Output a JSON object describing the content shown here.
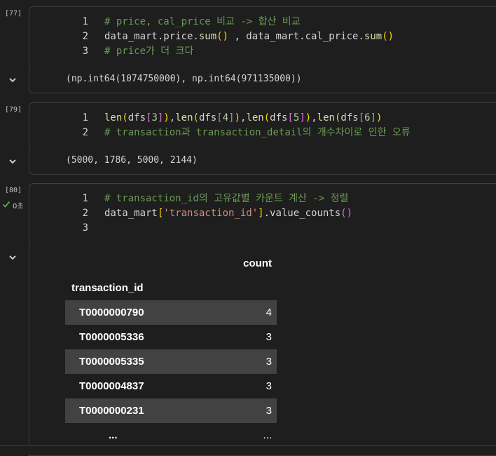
{
  "cells": [
    {
      "exec_count": "[77]",
      "lines": [
        {
          "num": "1",
          "segments": [
            {
              "text": "# price, cal_price 비교 -> 합산 비교",
              "cls": "cm"
            }
          ]
        },
        {
          "num": "2",
          "segments": [
            {
              "text": "data_mart.price.",
              "cls": ""
            },
            {
              "text": "sum",
              "cls": "fn"
            },
            {
              "text": "()",
              "cls": "paren"
            },
            {
              "text": " , data_mart.cal_price.",
              "cls": ""
            },
            {
              "text": "sum",
              "cls": "fn"
            },
            {
              "text": "()",
              "cls": "paren"
            }
          ]
        },
        {
          "num": "3",
          "segments": [
            {
              "text": "# price가 더 크다",
              "cls": "cm"
            }
          ]
        }
      ],
      "output": "(np.int64(1074750000), np.int64(971135000))"
    },
    {
      "exec_count": "[79]",
      "lines": [
        {
          "num": "1",
          "segments": [
            {
              "text": "len",
              "cls": "fn"
            },
            {
              "text": "(",
              "cls": "paren"
            },
            {
              "text": "dfs",
              "cls": ""
            },
            {
              "text": "[",
              "cls": "brk"
            },
            {
              "text": "3",
              "cls": "num"
            },
            {
              "text": "]",
              "cls": "brk"
            },
            {
              "text": ")",
              "cls": "paren"
            },
            {
              "text": ",",
              "cls": ""
            },
            {
              "text": "len",
              "cls": "fn"
            },
            {
              "text": "(",
              "cls": "paren"
            },
            {
              "text": "dfs",
              "cls": ""
            },
            {
              "text": "[",
              "cls": "brk"
            },
            {
              "text": "4",
              "cls": "num"
            },
            {
              "text": "]",
              "cls": "brk"
            },
            {
              "text": ")",
              "cls": "paren"
            },
            {
              "text": ",",
              "cls": ""
            },
            {
              "text": "len",
              "cls": "fn"
            },
            {
              "text": "(",
              "cls": "paren"
            },
            {
              "text": "dfs",
              "cls": ""
            },
            {
              "text": "[",
              "cls": "brk"
            },
            {
              "text": "5",
              "cls": "num"
            },
            {
              "text": "]",
              "cls": "brk"
            },
            {
              "text": ")",
              "cls": "paren"
            },
            {
              "text": ",",
              "cls": ""
            },
            {
              "text": "len",
              "cls": "fn"
            },
            {
              "text": "(",
              "cls": "paren"
            },
            {
              "text": "dfs",
              "cls": ""
            },
            {
              "text": "[",
              "cls": "brk"
            },
            {
              "text": "6",
              "cls": "num"
            },
            {
              "text": "]",
              "cls": "brk"
            },
            {
              "text": ")",
              "cls": "paren"
            }
          ]
        },
        {
          "num": "2",
          "segments": [
            {
              "text": "# transaction과 transaction_detail의 개수차이로 인한 오류",
              "cls": "cm"
            }
          ]
        }
      ],
      "output": "(5000, 1786, 5000, 2144)"
    },
    {
      "exec_count": "[80]",
      "status_text": "0초",
      "lines": [
        {
          "num": "1",
          "segments": [
            {
              "text": "# transaction_id의 고유값별 카운트 계산 -> 정렬",
              "cls": "cm"
            }
          ]
        },
        {
          "num": "2",
          "segments": [
            {
              "text": "data_mart",
              "cls": ""
            },
            {
              "text": "[",
              "cls": "paren"
            },
            {
              "text": "'transaction_id'",
              "cls": "str"
            },
            {
              "text": "]",
              "cls": "paren"
            },
            {
              "text": ".value_counts",
              "cls": ""
            },
            {
              "text": "()",
              "cls": "brk"
            }
          ]
        },
        {
          "num": "3",
          "segments": []
        }
      ],
      "table": {
        "column_header": "count",
        "index_header": "transaction_id",
        "rows": [
          {
            "id": "T0000000790",
            "count": "4"
          },
          {
            "id": "T0000005336",
            "count": "3"
          },
          {
            "id": "T0000005335",
            "count": "3"
          },
          {
            "id": "T0000004837",
            "count": "3"
          },
          {
            "id": "T0000000231",
            "count": "3"
          }
        ],
        "ellipsis_index": "...",
        "ellipsis_value": "..."
      }
    }
  ],
  "icons": {
    "collapse": "chevron-down-icon",
    "status_ok": "check-icon"
  },
  "colors": {
    "comment": "#6a9955",
    "function": "#dcdcaa",
    "number": "#b5cea8",
    "string": "#ce9178",
    "row_shade": "#424242"
  }
}
